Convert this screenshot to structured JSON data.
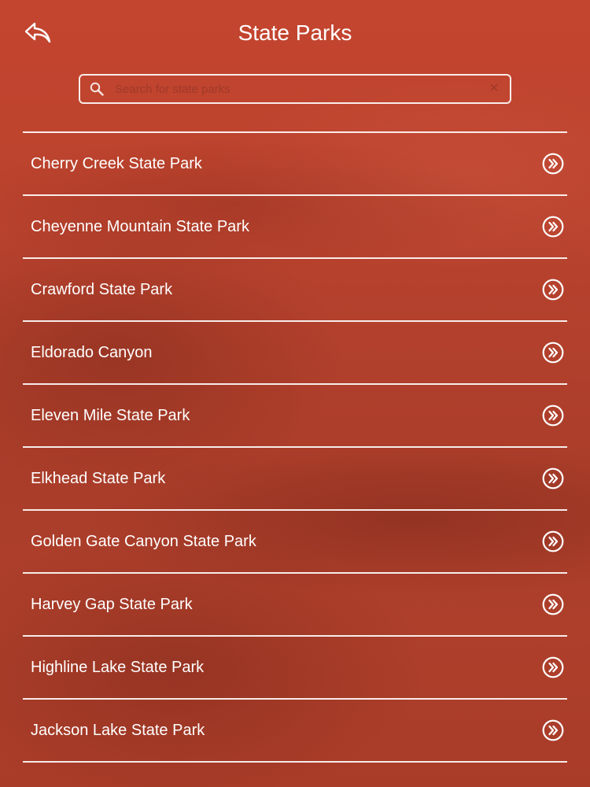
{
  "header": {
    "back_icon": "back-arrow-icon",
    "title": "State Parks"
  },
  "search": {
    "placeholder": "Search for state parks",
    "value": "",
    "search_icon": "search-icon",
    "clear_icon": "clear-icon",
    "clear_label": "✕"
  },
  "parks": [
    {
      "label": "Cherry Creek State Park",
      "icon": "chevron-right-circle-icon"
    },
    {
      "label": "Cheyenne Mountain State Park",
      "icon": "chevron-right-circle-icon"
    },
    {
      "label": "Crawford State Park",
      "icon": "chevron-right-circle-icon"
    },
    {
      "label": "Eldorado Canyon",
      "icon": "chevron-right-circle-icon"
    },
    {
      "label": "Eleven Mile State Park",
      "icon": "chevron-right-circle-icon"
    },
    {
      "label": "Elkhead State Park",
      "icon": "chevron-right-circle-icon"
    },
    {
      "label": "Golden Gate Canyon State Park",
      "icon": "chevron-right-circle-icon"
    },
    {
      "label": "Harvey Gap State Park",
      "icon": "chevron-right-circle-icon"
    },
    {
      "label": "Highline Lake State Park",
      "icon": "chevron-right-circle-icon"
    },
    {
      "label": "Jackson Lake State Park",
      "icon": "chevron-right-circle-icon"
    }
  ],
  "colors": {
    "background": "#b8432d",
    "foreground": "#ffffff"
  }
}
